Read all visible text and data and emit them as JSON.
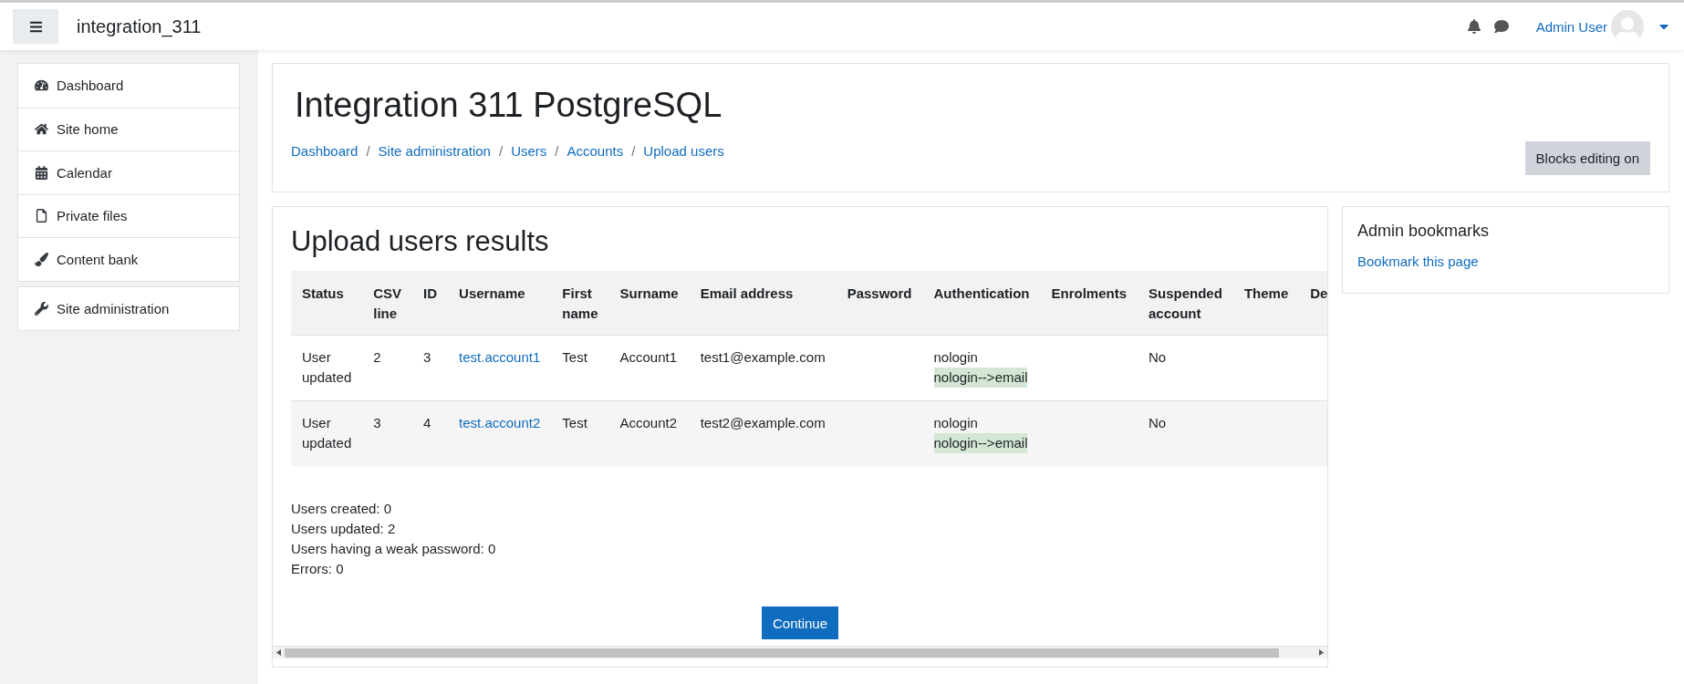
{
  "navbar": {
    "site_name": "integration_311",
    "user_name": "Admin User"
  },
  "nav_drawer": {
    "groups": [
      [
        {
          "label": "Dashboard"
        },
        {
          "label": "Site home"
        },
        {
          "label": "Calendar"
        },
        {
          "label": "Private files"
        },
        {
          "label": "Content bank"
        }
      ],
      [
        {
          "label": "Site administration"
        }
      ]
    ]
  },
  "page_header": {
    "title": "Integration 311 PostgreSQL",
    "breadcrumbs": [
      {
        "label": "Dashboard"
      },
      {
        "separator": "/",
        "label": "Site administration"
      },
      {
        "separator": "/",
        "label": "Users"
      },
      {
        "separator": "/",
        "label": "Accounts"
      },
      {
        "separator": "/",
        "label": "Upload users"
      }
    ],
    "edit_button": "Blocks editing on"
  },
  "results": {
    "heading": "Upload users results",
    "table": {
      "columns": [
        "Status",
        "CSV line",
        "ID",
        "Username",
        "First name",
        "Surname",
        "Email address",
        "Password",
        "Authentication",
        "Enrolments",
        "Suspended account",
        "Theme",
        "De"
      ],
      "rows": [
        {
          "status": "User updated",
          "csv_line": "2",
          "id": "3",
          "username": "test.account1",
          "first_name": "Test",
          "surname": "Account1",
          "email": "test1@example.com",
          "password": "",
          "authentication": [
            {
              "text": "nologin",
              "changed": false
            },
            {
              "text": "nologin-->email",
              "changed": true
            }
          ],
          "enrolments": "",
          "suspended": "No",
          "theme": ""
        },
        {
          "status": "User updated",
          "csv_line": "3",
          "id": "4",
          "username": "test.account2",
          "first_name": "Test",
          "surname": "Account2",
          "email": "test2@example.com",
          "password": "",
          "authentication": [
            {
              "text": "nologin",
              "changed": false
            },
            {
              "text": "nologin-->email",
              "changed": true
            }
          ],
          "enrolments": "",
          "suspended": "No",
          "theme": ""
        }
      ]
    },
    "summary": [
      "Users created: 0",
      "Users updated: 2",
      "Users having a weak password: 0",
      "Errors: 0"
    ],
    "continue_button": "Continue"
  },
  "block": {
    "title": "Admin bookmarks",
    "link": "Bookmark this page"
  }
}
